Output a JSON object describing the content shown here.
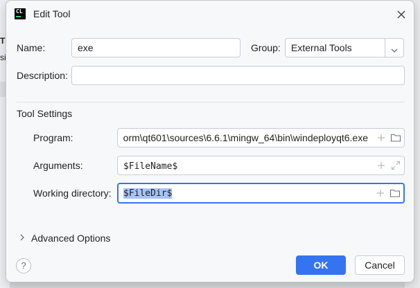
{
  "background": {
    "glyph_1": "T",
    "glyph_2": "si"
  },
  "dialog": {
    "title": "Edit Tool",
    "app_icon_text": "CL",
    "app_icon": "clion-logo-icon",
    "close_icon": "close-icon"
  },
  "form": {
    "name_label": "Name:",
    "name_value": "exe",
    "group_label": "Group:",
    "group_value": "External Tools",
    "description_label": "Description:",
    "description_value": ""
  },
  "tool_settings": {
    "title": "Tool Settings",
    "program_label": "Program:",
    "program_value": "orm\\qt601\\sources\\6.6.1\\mingw_64\\bin\\windeployqt6.exe",
    "arguments_label": "Arguments:",
    "arguments_value": "$FileName$",
    "working_dir_label": "Working directory:",
    "working_dir_value": "$FileDir$"
  },
  "advanced": {
    "label": "Advanced Options"
  },
  "buttons": {
    "help": "?",
    "ok": "OK",
    "cancel": "Cancel"
  },
  "colors": {
    "accent": "#3574f0",
    "selection": "#a6c4f7",
    "border": "#c9ccd6"
  }
}
